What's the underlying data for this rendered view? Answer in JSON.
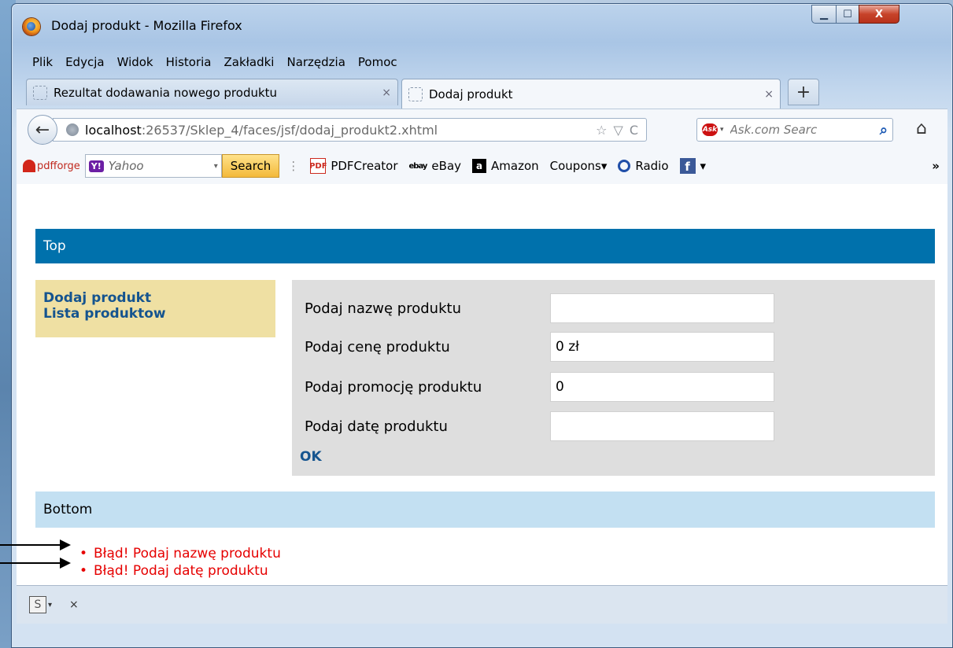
{
  "window": {
    "title": "Dodaj produkt - Mozilla Firefox",
    "min_glyph": "▁",
    "max_glyph": "☐",
    "close_glyph": "X"
  },
  "menu": [
    "Plik",
    "Edycja",
    "Widok",
    "Historia",
    "Zakładki",
    "Narzędzia",
    "Pomoc"
  ],
  "tabs": [
    {
      "title": "Rezultat dodawania nowego produktu",
      "close": "×"
    },
    {
      "title": "Dodaj produkt",
      "close": "×"
    }
  ],
  "new_tab": "+",
  "nav": {
    "back_glyph": "←",
    "url_host": "localhost",
    "url_rest": ":26537/Sklep_4/faces/jsf/dodaj_produkt2.xhtml",
    "star_glyph": "☆",
    "drop_glyph": "▽",
    "reload_glyph": "C",
    "search_placeholder": "Ask.com Searc",
    "search_glyph": "⌕",
    "ask_logo": "Ask",
    "home_glyph": "⌂"
  },
  "bookmarks": {
    "pdfforge": "pdfforge",
    "yahoo_logo": "Y!",
    "yahoo_text": "Yahoo",
    "search_button": "Search",
    "items": [
      {
        "icon": "PDF",
        "label": "PDFCreator"
      },
      {
        "icon": "ebay",
        "label": "eBay"
      },
      {
        "icon": "a",
        "label": "Amazon"
      },
      {
        "icon": "",
        "label": "Coupons▾"
      },
      {
        "icon": "",
        "label": "Radio"
      },
      {
        "icon": "f",
        "label": "▾"
      }
    ],
    "chevrons": "»"
  },
  "page": {
    "top_label": "Top",
    "nav_links": [
      "Dodaj produkt",
      "Lista produktow"
    ],
    "form": {
      "rows": [
        {
          "label": "Podaj nazwę produktu",
          "value": ""
        },
        {
          "label": "Podaj cenę produktu",
          "value": "0 zł"
        },
        {
          "label": "Podaj promocję produktu",
          "value": "0"
        },
        {
          "label": "Podaj datę produktu",
          "value": ""
        }
      ],
      "ok_label": "OK"
    },
    "bottom_label": "Bottom",
    "errors": [
      "Błąd! Podaj nazwę produktu",
      "Błąd! Podaj datę produktu"
    ]
  },
  "statusbar": {
    "s_icon": "S",
    "drop": "▾",
    "close": "×"
  }
}
